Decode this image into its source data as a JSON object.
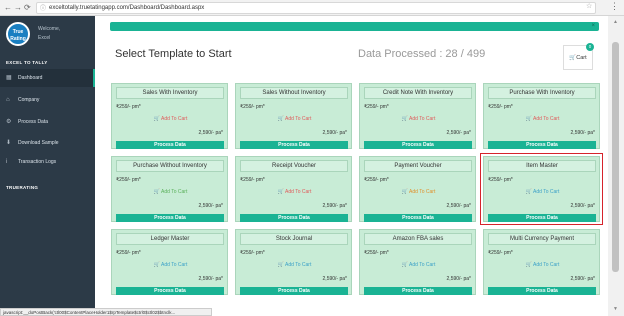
{
  "browser": {
    "url": "exceltotally.truetatingapp.com/Dashboard/Dashboard.aspx"
  },
  "sidebar": {
    "logo_text": "True Rating",
    "welcome": "Welcome,",
    "user": "Excel",
    "section_title": "EXCEL TO TALLY",
    "items": [
      {
        "label": "Dashboard",
        "icon": "dashboard-icon"
      },
      {
        "label": "Company",
        "icon": "bank-icon"
      },
      {
        "label": "Process Data",
        "icon": "gears-icon"
      },
      {
        "label": "Download Sample",
        "icon": "download-icon"
      },
      {
        "label": "Transaction Logs",
        "icon": "info-icon"
      }
    ],
    "section2_title": "TRUERATING"
  },
  "main": {
    "title": "Select Template to Start",
    "processed": "Data Processed : 28 / 499",
    "cart_label": "Cart",
    "cart_count": "0"
  },
  "cards": [
    {
      "name": "Sales With Inventory",
      "pm": "₹259/- pm*",
      "add": "Add To Cart",
      "add_color": "#e05a5a",
      "pa": "2,590/- pa*",
      "btn": "Process Data"
    },
    {
      "name": "Sales Without Inventory",
      "pm": "₹259/- pm*",
      "add": "Add To Cart",
      "add_color": "#e05a5a",
      "pa": "2,590/- pa*",
      "btn": "Process Data"
    },
    {
      "name": "Credit Note With Inventory",
      "pm": "₹259/- pm*",
      "add": "Add To Cart",
      "add_color": "#e05a5a",
      "pa": "2,590/- pa*",
      "btn": "Process Data"
    },
    {
      "name": "Purchase With Inventory",
      "pm": "₹259/- pm*",
      "add": "Add To Cart",
      "add_color": "#e05a5a",
      "pa": "2,590/- pa*",
      "btn": "Process Data"
    },
    {
      "name": "Purchase Without Inventory",
      "pm": "₹259/- pm*",
      "add": "Add To Cart",
      "add_color": "#5ab05a",
      "pa": "2,590/- pa*",
      "btn": "Process Data"
    },
    {
      "name": "Receipt Voucher",
      "pm": "₹259/- pm*",
      "add": "Add To Cart",
      "add_color": "#e05a5a",
      "pa": "2,590/- pa*",
      "btn": "Process Data"
    },
    {
      "name": "Payment Voucher",
      "pm": "₹259/- pm*",
      "add": "Add To Cart",
      "add_color": "#e0902a",
      "pa": "2,590/- pa*",
      "btn": "Process Data"
    },
    {
      "name": "Item Master",
      "pm": "₹259/- pm*",
      "add": "Add To Cart",
      "add_color": "#3aa0c8",
      "pa": "2,590/- pa*",
      "btn": "Process Data"
    },
    {
      "name": "Ledger Master",
      "pm": "₹259/- pm*",
      "add": "Add To Cart",
      "add_color": "#3aa0c8",
      "pa": "2,590/- pa*",
      "btn": "Process Data"
    },
    {
      "name": "Stock Journal",
      "pm": "₹259/- pm*",
      "add": "Add To Cart",
      "add_color": "#3aa0c8",
      "pa": "2,590/- pa*",
      "btn": "Process Data"
    },
    {
      "name": "Amazon FBA sales",
      "pm": "₹259/- pm*",
      "add": "Add To Cart",
      "add_color": "#3aa0c8",
      "pa": "2,590/- pa*",
      "btn": "Process Data"
    },
    {
      "name": "Multi Currency Payment",
      "pm": "₹259/- pm*",
      "add": "Add To Cart",
      "add_color": "#3aa0c8",
      "pa": "2,590/- pa*",
      "btn": "Process Data"
    }
  ],
  "status_bar": "javascript:__doPostBack('ctl00$ContentPlaceHolder1$rpTemplate$ctrl0$ctl02$btnclk...",
  "colors": {
    "accent": "#1ab394",
    "sidebar_bg": "#2c3a47",
    "card_bg": "#c8ecd6",
    "highlight": "#d6232b"
  }
}
